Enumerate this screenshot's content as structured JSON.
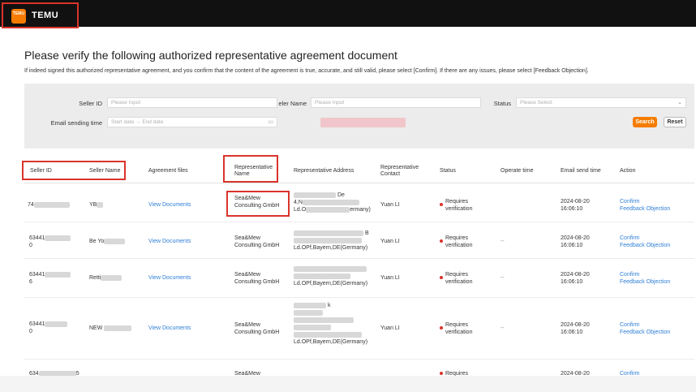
{
  "brand": {
    "name": "TEMU",
    "mark": "TEMU"
  },
  "page": {
    "title": "Please verify the following authorized representative agreement document",
    "subtitle": "If indeed signed this authorized representative agreement,  and you confirm that the content of the agreement is true, accurate, and still valid, please select [Confirm]. If there are any issues, please select [Feedback Objection]."
  },
  "filters": {
    "seller_id_label": "Seller ID",
    "seller_id_placeholder": "Please Input",
    "seller_name_label": "eler Name",
    "seller_name_placeholder": "Please Input",
    "status_label": "Status",
    "status_placeholder": "Please Select",
    "email_time_label": "Email sending time",
    "start_date_placeholder": "Start date",
    "arrow": "→",
    "end_date_placeholder": "End date",
    "search_label": "Search",
    "reset_label": "Reset"
  },
  "table": {
    "headers": {
      "seller_id": "Seller ID",
      "seller_name": "Seller Name",
      "agreement_files": "Agreement files",
      "rep_name_1": "Representative",
      "rep_name_2": "Name",
      "rep_address": "Representative Address",
      "rep_contact_1": "Representative",
      "rep_contact_2": "Contact",
      "status": "Status",
      "operate_time": "Operate time",
      "email_send_time": "Email send time",
      "action": "Action"
    },
    "rows": [
      {
        "seller_id_a": "74",
        "seller_id_b": "",
        "seller_name": "YB",
        "files": "View Documents",
        "rep_1": "Sea&Mew",
        "rep_2": "Consulting GmbH",
        "addr_1": "De",
        "addr_2": "4,N",
        "addr_3": "Ld.O",
        "addr_4": "ermany)",
        "contact": "Yuan LI",
        "status_1": "Requires",
        "status_2": "verification",
        "operate": "",
        "date": "2024-08-20",
        "time": "16:06:10",
        "confirm": "Confirm",
        "objection": "Feedback Objection"
      },
      {
        "seller_id_a": "63441",
        "seller_id_b": "0",
        "seller_name": "Be Yo",
        "files": "View Documents",
        "rep_1": "Sea&Mew",
        "rep_2": "Consulting GmbH",
        "addr_1": "B",
        "addr_2": "",
        "addr_3": "Ld.OPf,Bayern,DE(Germany)",
        "addr_4": "",
        "contact": "Yuan LI",
        "status_1": "Requires",
        "status_2": "verification",
        "operate": "--",
        "date": "2024-08-20",
        "time": "16:06:10",
        "confirm": "Confirm",
        "objection": "Feedback Objection"
      },
      {
        "seller_id_a": "63441",
        "seller_id_b": "6",
        "seller_name": "Retti",
        "files": "View Documents",
        "rep_1": "Sea&Mew",
        "rep_2": "Consulting GmbH",
        "addr_1": "",
        "addr_2": "",
        "addr_3": "Ld.OPf,Bayern,DE(Germany)",
        "addr_4": "",
        "contact": "Yuan LI",
        "status_1": "Requires",
        "status_2": "verification",
        "operate": "--",
        "date": "2024-08-20",
        "time": "16:06:10",
        "confirm": "Confirm",
        "objection": "Feedback Objection"
      },
      {
        "seller_id_a": "63441",
        "seller_id_b": "0",
        "seller_name": "NEW",
        "files": "View Documents",
        "rep_1": "Sea&Mew",
        "rep_2": "Consulting GmbH",
        "addr_1": "k",
        "addr_2": "",
        "addr_3": "Ld.OPf,Bayern,DE(Germany)",
        "addr_4": "",
        "contact": "Yuan LI",
        "status_1": "Requires",
        "status_2": "verification",
        "operate": "--",
        "date": "2024-08-20",
        "time": "16:06:10",
        "confirm": "Confirm",
        "objection": "Feedback Objection"
      },
      {
        "seller_id_a": "634",
        "seller_id_b": "5",
        "seller_name": "",
        "files": "",
        "rep_1": "Sea&Mew",
        "rep_2": "",
        "addr_1": "",
        "addr_2": "",
        "addr_3": "",
        "addr_4": "",
        "contact": "",
        "status_1": "Requires",
        "status_2": "",
        "operate": "",
        "date": "2024-08-20",
        "time": "",
        "confirm": "Confirm",
        "objection": ""
      }
    ]
  },
  "colors": {
    "accent": "#f57c00",
    "highlight": "#d9342b",
    "link": "#2f7fd6",
    "topbar": "#111111"
  }
}
